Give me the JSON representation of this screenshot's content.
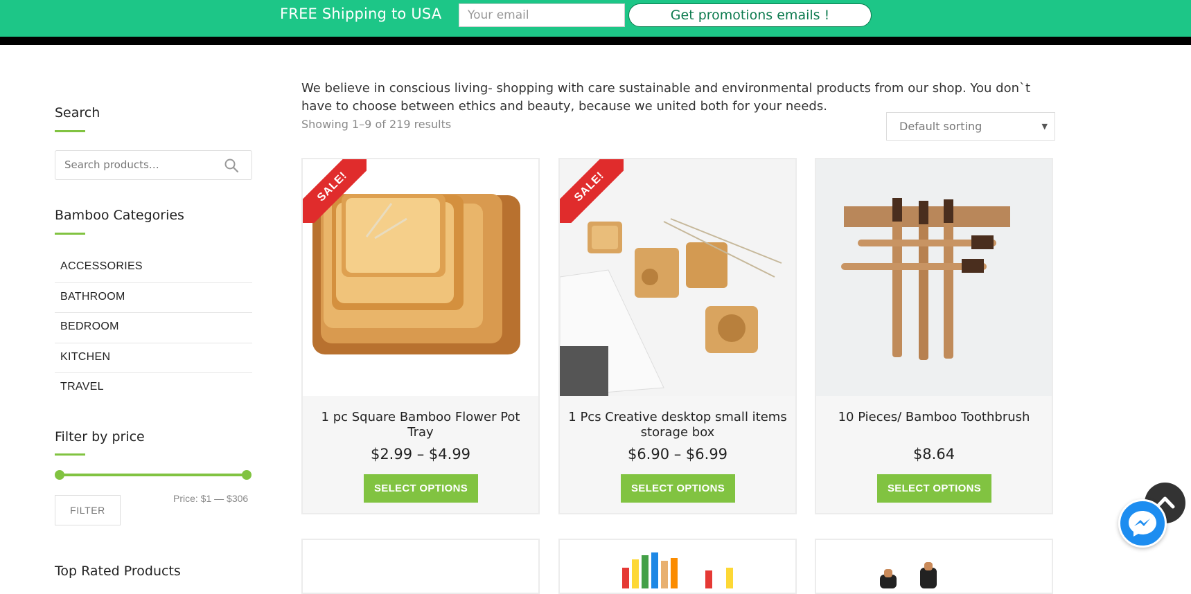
{
  "topbar": {
    "shipping_text": "FREE Shipping to USA",
    "email_placeholder": "Your email",
    "promo_button": "Get promotions emails !"
  },
  "sidebar": {
    "search_title": "Search",
    "search_placeholder": "Search products…",
    "categories_title": "Bamboo Categories",
    "categories": [
      "ACCESSORIES",
      "BATHROOM",
      "BEDROOM",
      "KITCHEN",
      "TRAVEL"
    ],
    "filter_title": "Filter by price",
    "filter_button": "FILTER",
    "price_range": "Price: $1 — $306",
    "top_rated_title": "Top Rated Products"
  },
  "main": {
    "intro": "We believe in conscious living- shopping with care sustainable and environmental products from our shop. You don`t have to choose between ethics and beauty, because we united both for your needs.",
    "showing": "Showing 1–9 of 219 results",
    "sorting": "Default sorting",
    "products": [
      {
        "name": "1 pc Square Bamboo Flower Pot Tray",
        "price": "$2.99 – $4.99",
        "button": "SELECT OPTIONS",
        "badge": "SALE!"
      },
      {
        "name": "1 Pcs Creative desktop small items storage box",
        "price": "$6.90 – $6.99",
        "button": "SELECT OPTIONS",
        "badge": "SALE!"
      },
      {
        "name": "10 Pieces/ Bamboo Toothbrush",
        "price": "$8.64",
        "button": "SELECT OPTIONS",
        "badge": ""
      }
    ]
  },
  "colors": {
    "topbar": "#1dc687",
    "accent": "#81c341",
    "sale": "#e02c2c",
    "messenger": "#1d8df0"
  },
  "icons": [
    "search-icon",
    "chevron-up-icon",
    "messenger-icon"
  ]
}
